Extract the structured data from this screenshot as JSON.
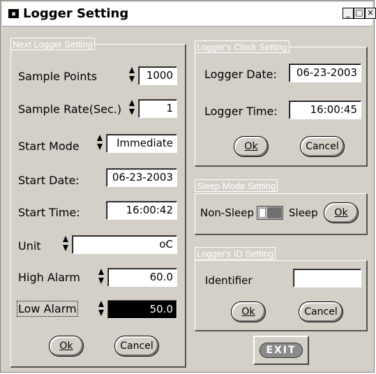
{
  "window": {
    "title": "Logger Setting",
    "icon": "app-icon",
    "controls": [
      "_",
      "□",
      "×"
    ]
  },
  "next_logger": {
    "title": "Next Logger Setting",
    "sample_points": {
      "label": "Sample Points",
      "value": "1000"
    },
    "sample_rate": {
      "label": "Sample Rate(Sec.)",
      "value": "1"
    },
    "start_mode": {
      "label": "Start Mode",
      "value": "Immediate"
    },
    "start_date": {
      "label": "Start Date:",
      "value": "06-23-2003"
    },
    "start_time": {
      "label": "Start Time:",
      "value": "16:00:42"
    },
    "unit": {
      "label": "Unit",
      "value": "oC"
    },
    "high_alarm": {
      "label": "High Alarm",
      "value": "60.0"
    },
    "low_alarm": {
      "label": "Low Alarm",
      "value": "50.0"
    },
    "ok_label": "Ok",
    "cancel_label": "Cancel"
  },
  "clock": {
    "title": "Logger's Clock Setting",
    "date": {
      "label": "Logger Date:",
      "value": "06-23-2003"
    },
    "time": {
      "label": "Logger Time:",
      "value": "16:00:45"
    },
    "ok_label": "Ok",
    "cancel_label": "Cancel"
  },
  "sleep": {
    "title": "Sleep Mode Setting",
    "non_sleep_label": "Non-Sleep",
    "sleep_label": "Sleep",
    "ok_label": "Ok"
  },
  "identity": {
    "title": "Logger's ID Setting",
    "identifier_label": "Identifier",
    "identifier_value": "",
    "ok_label": "Ok",
    "cancel_label": "Cancel"
  },
  "exit_label": "EXIT"
}
